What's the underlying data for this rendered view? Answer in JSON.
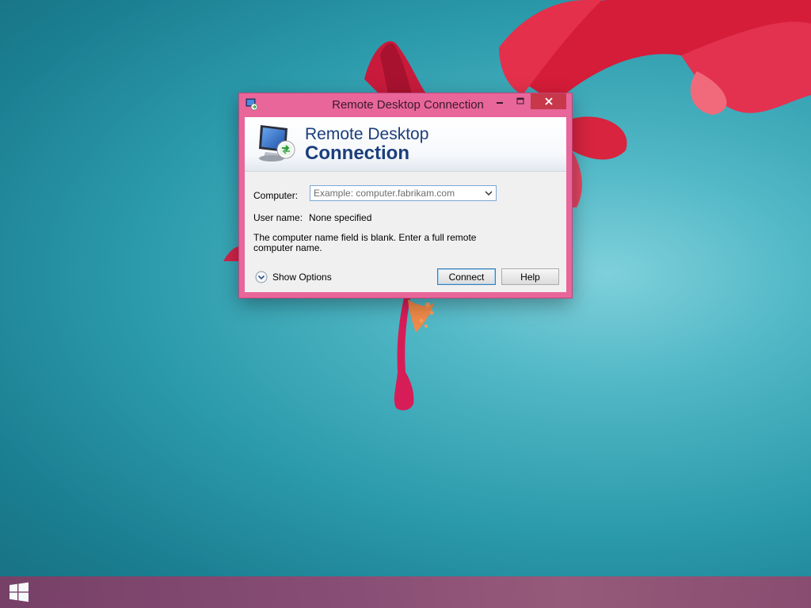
{
  "window": {
    "title": "Remote Desktop Connection",
    "banner_line1": "Remote Desktop",
    "banner_line2": "Connection"
  },
  "form": {
    "computer_label": "Computer:",
    "computer_value": "",
    "computer_placeholder": "Example: computer.fabrikam.com",
    "username_label": "User name:",
    "username_value": "None specified",
    "message": "The computer name field is blank. Enter a full remote computer name."
  },
  "actions": {
    "show_options": "Show Options",
    "connect": "Connect",
    "help": "Help"
  },
  "icons": {
    "app": "remote-desktop-icon",
    "banner": "monitor-connection-icon",
    "minimize": "minimize-icon",
    "maximize": "maximize-icon",
    "close": "close-icon",
    "dropdown": "chevron-down-icon",
    "expand": "expand-options-icon",
    "start": "windows-logo-icon"
  },
  "colors": {
    "window_frame": "#e8669a",
    "close_button": "#c7384a",
    "banner_text": "#1b3e7c",
    "taskbar": "#8c4a73"
  }
}
